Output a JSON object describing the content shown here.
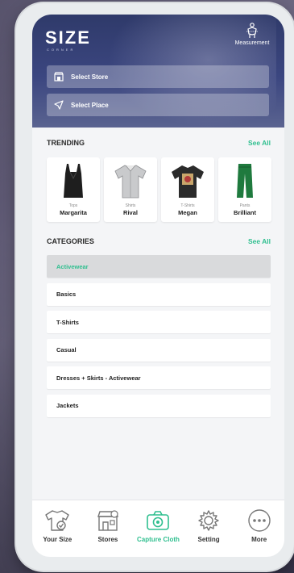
{
  "brand": {
    "logo": "SIZE",
    "logo_sub": "CORNER"
  },
  "header": {
    "measurement_label": "Measurement",
    "select_store": "Select Store",
    "select_place": "Select Place"
  },
  "trending": {
    "title": "TRENDING",
    "see_all": "See All",
    "items": [
      {
        "type": "Tops",
        "name": "Margarita"
      },
      {
        "type": "Shirts",
        "name": "Rival"
      },
      {
        "type": "T-Shirts",
        "name": "Megan"
      },
      {
        "type": "Pants",
        "name": "Brilliant"
      }
    ]
  },
  "categories": {
    "title": "CATEGORIES",
    "see_all": "See All",
    "items": [
      {
        "label": "Activewear",
        "active": true
      },
      {
        "label": "Basics"
      },
      {
        "label": "T-Shirts"
      },
      {
        "label": "Casual"
      },
      {
        "label": "Dresses + Skirts - Activewear"
      },
      {
        "label": "Jackets"
      }
    ]
  },
  "tabbar": {
    "items": [
      {
        "label": "Your Size",
        "icon": "shirt-check-icon"
      },
      {
        "label": "Stores",
        "icon": "store-icon"
      },
      {
        "label": "Capture Cloth",
        "icon": "camera-icon",
        "active": true
      },
      {
        "label": "Setting",
        "icon": "gear-icon"
      },
      {
        "label": "More",
        "icon": "more-dots-icon"
      }
    ]
  },
  "colors": {
    "accent": "#2fbf8f",
    "header": "#3b4680"
  }
}
